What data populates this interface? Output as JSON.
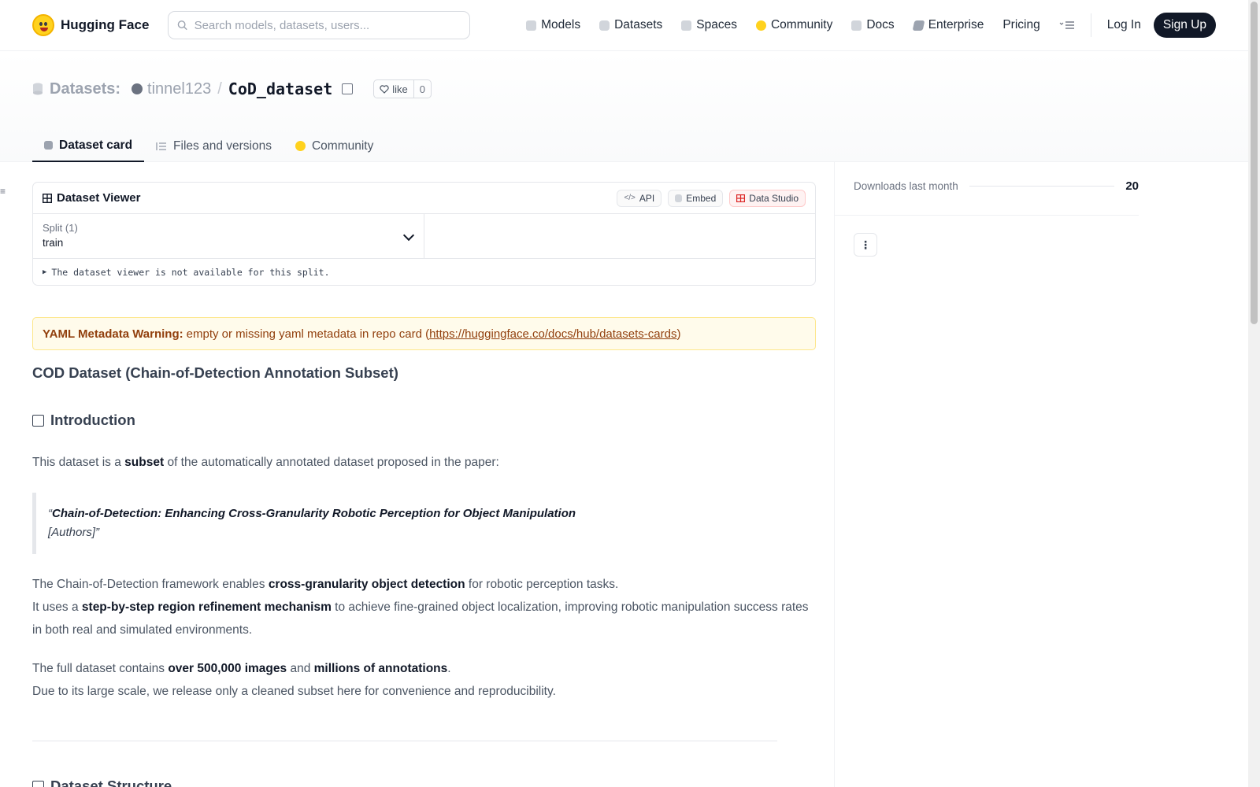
{
  "nav": {
    "brand": "Hugging Face",
    "search_placeholder": "Search models, datasets, users...",
    "links": [
      {
        "label": "Models",
        "icon": "cube-icon",
        "color": "#9ca3af"
      },
      {
        "label": "Datasets",
        "icon": "database-icon",
        "color": "#9ca3af"
      },
      {
        "label": "Spaces",
        "icon": "grid-icon",
        "color": "#9ca3af"
      },
      {
        "label": "Community",
        "icon": "hug-icon",
        "color": "#FFD21E"
      },
      {
        "label": "Docs",
        "icon": "book-icon",
        "color": "#9ca3af"
      },
      {
        "label": "Enterprise",
        "icon": "enterprise-icon",
        "color": "#9ca3af"
      },
      {
        "label": "Pricing"
      }
    ],
    "login": "Log In",
    "signup": "Sign Up"
  },
  "repo": {
    "section": "Datasets:",
    "owner": "tinnel123",
    "separator": "/",
    "name": "CoD_dataset",
    "like_label": "like",
    "like_count": "0"
  },
  "tabs": [
    {
      "label": "Dataset card",
      "active": true
    },
    {
      "label": "Files and versions",
      "active": false
    },
    {
      "label": "Community",
      "active": false
    }
  ],
  "viewer": {
    "title": "Dataset Viewer",
    "actions": [
      "API",
      "Embed",
      "Data Studio"
    ],
    "split_label": "Split (1)",
    "split_value": "train",
    "message": "The dataset viewer is not available for this split."
  },
  "warning": {
    "bold": "YAML Metadata Warning:",
    "text": "empty or missing yaml metadata in repo card (",
    "link": "https://huggingface.co/docs/hub/datasets-cards",
    "close": ")"
  },
  "content": {
    "title": "COD Dataset (Chain-of-Detection Annotation Subset)",
    "intro_heading": "Introduction",
    "p1_a": "This dataset is a ",
    "p1_b": "subset",
    "p1_c": " of the automatically annotated dataset proposed in the paper:",
    "quote_open": "“",
    "quote_title": "Chain-of-Detection: Enhancing Cross-Granularity Robotic Perception for Object Manipulation",
    "quote_authors": "[Authors]”",
    "p2_a": "The Chain-of-Detection framework enables ",
    "p2_b": "cross-granularity object detection",
    "p2_c": " for robotic perception tasks.",
    "p2_d": "It uses a ",
    "p2_e": "step-by-step region refinement mechanism",
    "p2_f": " to achieve fine-grained object localization, improving robotic manipulation success rates in both real and simulated environments.",
    "p3_a": "The full dataset contains ",
    "p3_b": "over 500,000 images",
    "p3_c": " and ",
    "p3_d": "millions of annotations",
    "p3_e": ".",
    "p3_f": "Due to its large scale, we release only a cleaned subset here for convenience and reproducibility.",
    "structure_heading": "Dataset Structure"
  },
  "sidebar": {
    "downloads_label": "Downloads last month",
    "downloads_value": "20"
  }
}
